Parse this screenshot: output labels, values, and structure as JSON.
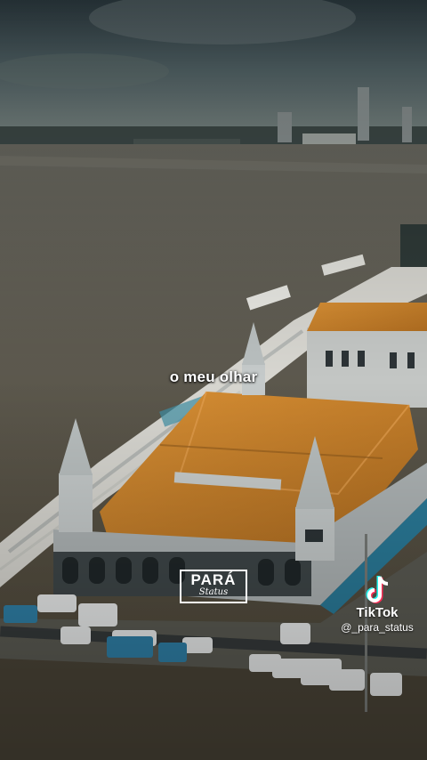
{
  "overlay": {
    "subtitle": "o meu olhar",
    "logo_main": "PARÁ",
    "logo_script": "Status"
  },
  "tiktok": {
    "brand": "TikTok",
    "handle": "@_para_status",
    "icon": "tiktok-icon"
  },
  "colors": {
    "sky": "#4a5c62",
    "river": "#5a5247",
    "roof": "#c9822a",
    "building": "#b8bdbf"
  }
}
